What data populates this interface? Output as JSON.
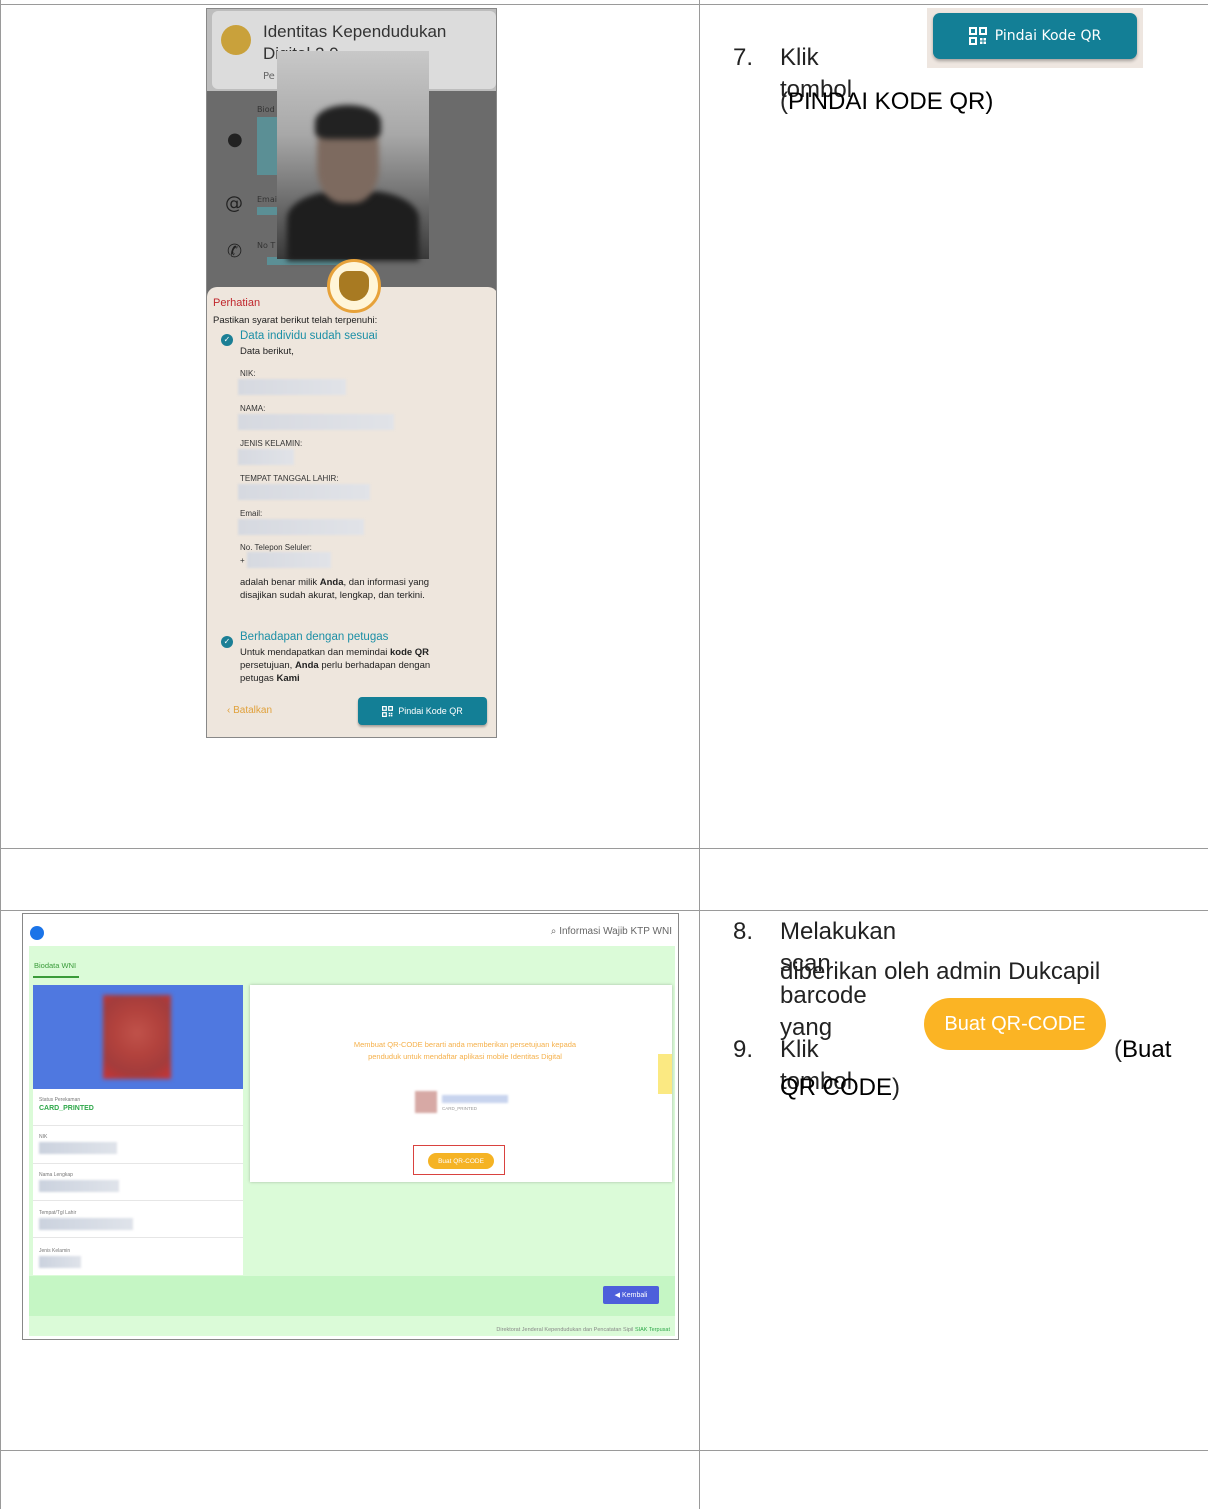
{
  "steps": [
    {
      "num": "7.",
      "pre": "Klik tombol",
      "paren_open": "(",
      "bold": "PINDAI KODE QR)",
      "paren_close": ""
    },
    {
      "num": "8.",
      "line1": "Melakukan scan barcode yang",
      "line2": "diberikan oleh admin Dukcapil"
    },
    {
      "num": "9.",
      "pre": "Klik tombol",
      "paren_open": "(",
      "bold1": "Buat",
      "bold2": "QR CODE",
      "paren_close": ")"
    }
  ],
  "big_buttons": {
    "pindai": "Pindai Kode QR",
    "buat": "Buat QR-CODE"
  },
  "phone": {
    "title": "Identitas Kependudukan Digital 2.0",
    "subtitle_partial": "Pe",
    "fields_partial": [
      "Biod",
      "Emai",
      "No T"
    ],
    "sheet_title": "Perhatian",
    "intro": "Pastikan syarat berikut telah terpenuhi:",
    "check1_title": "Data individu sudah sesuai",
    "check1_sub": "Data berikut,",
    "labels": [
      "NIK:",
      "NAMA:",
      "JENIS KELAMIN:",
      "TEMPAT TANGGAL LAHIR:",
      "Email:",
      "No. Telepon Seluler:"
    ],
    "phone_prefix": "+",
    "statement_a": "adalah benar milik ",
    "statement_bold": "Anda",
    "statement_b": ", dan informasi yang",
    "statement_c": "disajikan sudah akurat, lengkap, dan terkini.",
    "check2_title": "Berhadapan dengan petugas",
    "check2_l1a": "Untuk mendapatkan dan memindai ",
    "check2_l1b": "kode QR",
    "check2_l2a": "persetujuan, ",
    "check2_l2b": "Anda",
    "check2_l2c": " perlu berhadapan dengan",
    "check2_l3a": "petugas ",
    "check2_l3b": "Kami",
    "cancel": "‹  Batalkan",
    "scan_button": "Pindai Kode QR"
  },
  "web": {
    "search_label": "Informasi Wajib KTP WNI",
    "tab": "Biodata WNI",
    "status_label": "Status Perekaman",
    "status_value": "CARD_PRINTED",
    "nik_label": "NIK",
    "nama_label": "Nama Lengkap",
    "ttl_label": "Tempat/Tgl Lahir",
    "jk_label": "Jenis Kelamin",
    "dialog_msg": "Membuat QR-CODE berarti anda memberikan persetujuan kepada penduduk untuk mendaftar aplikasi mobile Identitas Digital",
    "dialog_status": "CARD_PRINTED",
    "buat_button": "Buat QR-CODE",
    "kembali": "Kembali",
    "footer_text": "Direktorat Jenderal Kependudukan dan Pencatatan Sipil",
    "footer_link": "SIAK Terpusat"
  },
  "colors": {
    "teal": "#137f96",
    "amber": "#fbb424",
    "alert_red": "#c0272d",
    "web_green": "#dbfbd8",
    "kembali_blue": "#4d5fdb"
  }
}
